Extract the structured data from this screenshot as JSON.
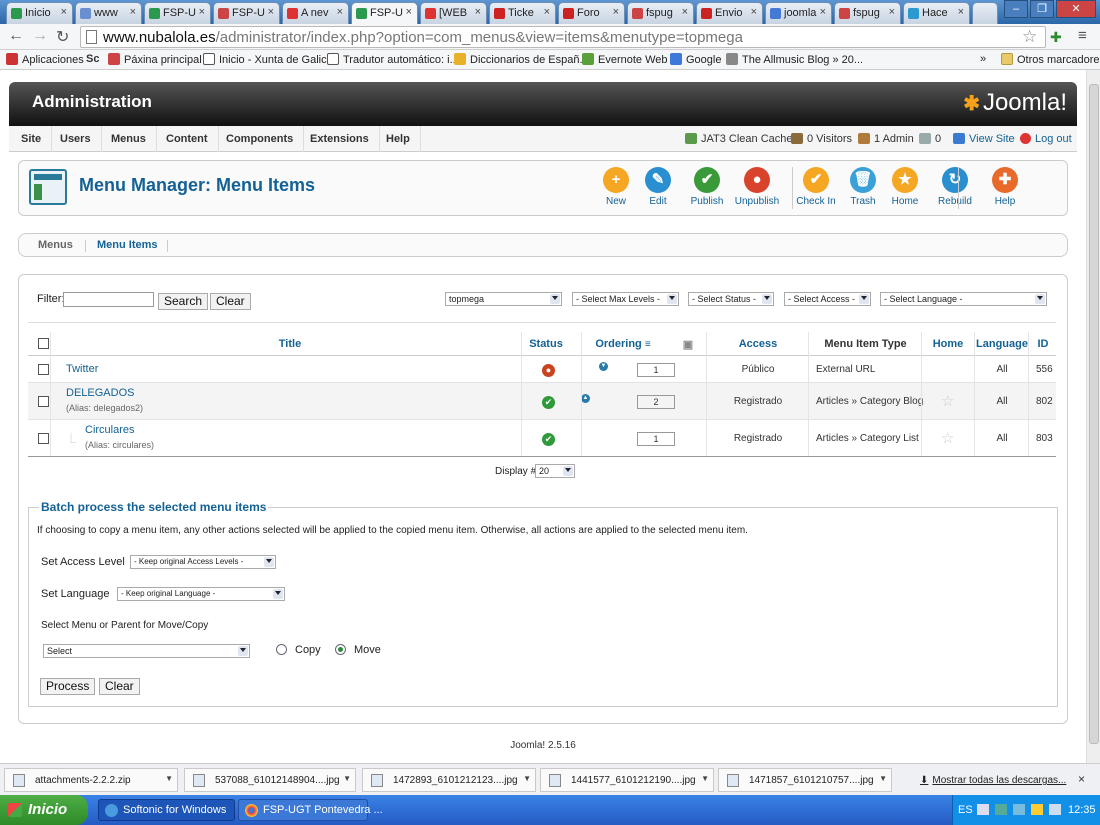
{
  "browser": {
    "tabs": [
      {
        "label": "Inicio",
        "color": "#2b9a4e"
      },
      {
        "label": "www",
        "color": "#6a8fd1"
      },
      {
        "label": "FSP-U",
        "color": "#2b9a4e"
      },
      {
        "label": "FSP-U",
        "color": "#c44"
      },
      {
        "label": "A nev",
        "color": "#d33"
      },
      {
        "label": "FSP-U",
        "color": "#2b9a4e"
      },
      {
        "label": "[WEB",
        "color": "#d33"
      },
      {
        "label": "Ticke",
        "color": "#c22"
      },
      {
        "label": "Foro",
        "color": "#c22"
      },
      {
        "label": "fspug",
        "color": "#c44"
      },
      {
        "label": "Envio",
        "color": "#c22"
      },
      {
        "label": "joomla",
        "color": "#4479d4"
      },
      {
        "label": "fspug",
        "color": "#c44"
      },
      {
        "label": "Hace",
        "color": "#2a9ad0"
      }
    ],
    "url_domain": "www.nubalola.es",
    "url_path": "/administrator/index.php?option=com_menus&view=items&menutype=topmega",
    "bookmarks": [
      "Aplicaciones",
      "Páxina principal",
      "Inicio - Xunta de Galicia",
      "Tradutor automático: i...",
      "Diccionarios de Españ...",
      "Evernote Web",
      "Google",
      "The Allmusic Blog » 20..."
    ],
    "bookmarks_more": "»",
    "other_bookmarks": "Otros marcadores"
  },
  "admin": {
    "title": "Administration",
    "brand": "Joomla!",
    "menu": [
      "Site",
      "Users",
      "Menus",
      "Content",
      "Components",
      "Extensions",
      "Help"
    ],
    "status": {
      "cache": "JAT3 Clean Cache",
      "visitors": "0 Visitors",
      "admins": "1 Admin",
      "messages": "0",
      "view_site": "View Site",
      "logout": "Log out"
    }
  },
  "toolbar": {
    "page_title": "Menu Manager: Menu Items",
    "buttons": [
      {
        "label": "New",
        "color": "#f5a623",
        "glyph": "+"
      },
      {
        "label": "Edit",
        "color": "#2a8fd0",
        "glyph": "✎"
      },
      {
        "label": "Publish",
        "color": "#3a9a3a",
        "glyph": "✔"
      },
      {
        "label": "Unpublish",
        "color": "#d9432b",
        "glyph": "●"
      },
      {
        "label": "Check In",
        "color": "#f5a623",
        "glyph": "✔"
      },
      {
        "label": "Trash",
        "color": "#3aa0d8",
        "glyph": "🗑"
      },
      {
        "label": "Home",
        "color": "#f5a623",
        "glyph": "★"
      },
      {
        "label": "Rebuild",
        "color": "#2a8fd0",
        "glyph": "↻"
      },
      {
        "label": "Help",
        "color": "#e86a2a",
        "glyph": "✚"
      }
    ]
  },
  "subnav": {
    "menus": "Menus",
    "menu_items": "Menu Items"
  },
  "filter": {
    "label": "Filter:",
    "value": "",
    "search": "Search",
    "clear": "Clear",
    "menu_select": "topmega",
    "max_levels": "- Select Max Levels -",
    "status": "- Select Status -",
    "access": "- Select Access -",
    "language": "- Select Language -"
  },
  "table": {
    "headers": {
      "title": "Title",
      "status": "Status",
      "ordering": "Ordering",
      "access": "Access",
      "type": "Menu Item Type",
      "home": "Home",
      "language": "Language",
      "id": "ID"
    },
    "rows": [
      {
        "title": "Twitter",
        "alias": "",
        "status": "unpublished",
        "order": "1",
        "access": "Público",
        "type": "External URL",
        "home": "",
        "language": "All",
        "id": "556"
      },
      {
        "title": "DELEGADOS",
        "alias": "(Alias: delegados2)",
        "status": "published",
        "order": "2",
        "access": "Registrado",
        "type": "Articles » Category Blog",
        "home": "☆",
        "language": "All",
        "id": "802"
      },
      {
        "title": "Circulares",
        "alias": "(Alias: circulares)",
        "status": "published",
        "order": "1",
        "access": "Registrado",
        "type": "Articles » Category List",
        "home": "☆",
        "language": "All",
        "id": "803"
      }
    ],
    "display_label": "Display #",
    "display_value": "20"
  },
  "batch": {
    "legend": "Batch process the selected menu items",
    "note": "If choosing to copy a menu item, any other actions selected will be applied to the copied menu item. Otherwise, all actions are applied to the selected menu item.",
    "access_label": "Set Access Level",
    "access_value": "- Keep original Access Levels -",
    "language_label": "Set Language",
    "language_value": "- Keep original Language -",
    "move_label": "Select Menu or Parent for Move/Copy",
    "move_value": "Select",
    "copy": "Copy",
    "move": "Move",
    "process": "Process",
    "clear": "Clear"
  },
  "footer": {
    "version": "Joomla! 2.5.16"
  },
  "downloads": {
    "items": [
      "attachments-2.2.2.zip",
      "537088_61012148904....jpg",
      "1472893_6101212123....jpg",
      "1441577_6101212190....jpg",
      "1471857_6101210757....jpg"
    ],
    "show_all": "Mostrar todas las descargas...",
    "close": "×"
  },
  "taskbar": {
    "start": "Inicio",
    "tasks": [
      "Softonic for Windows",
      "FSP-UGT Pontevedra ..."
    ],
    "lang": "ES",
    "time": "12:35"
  }
}
